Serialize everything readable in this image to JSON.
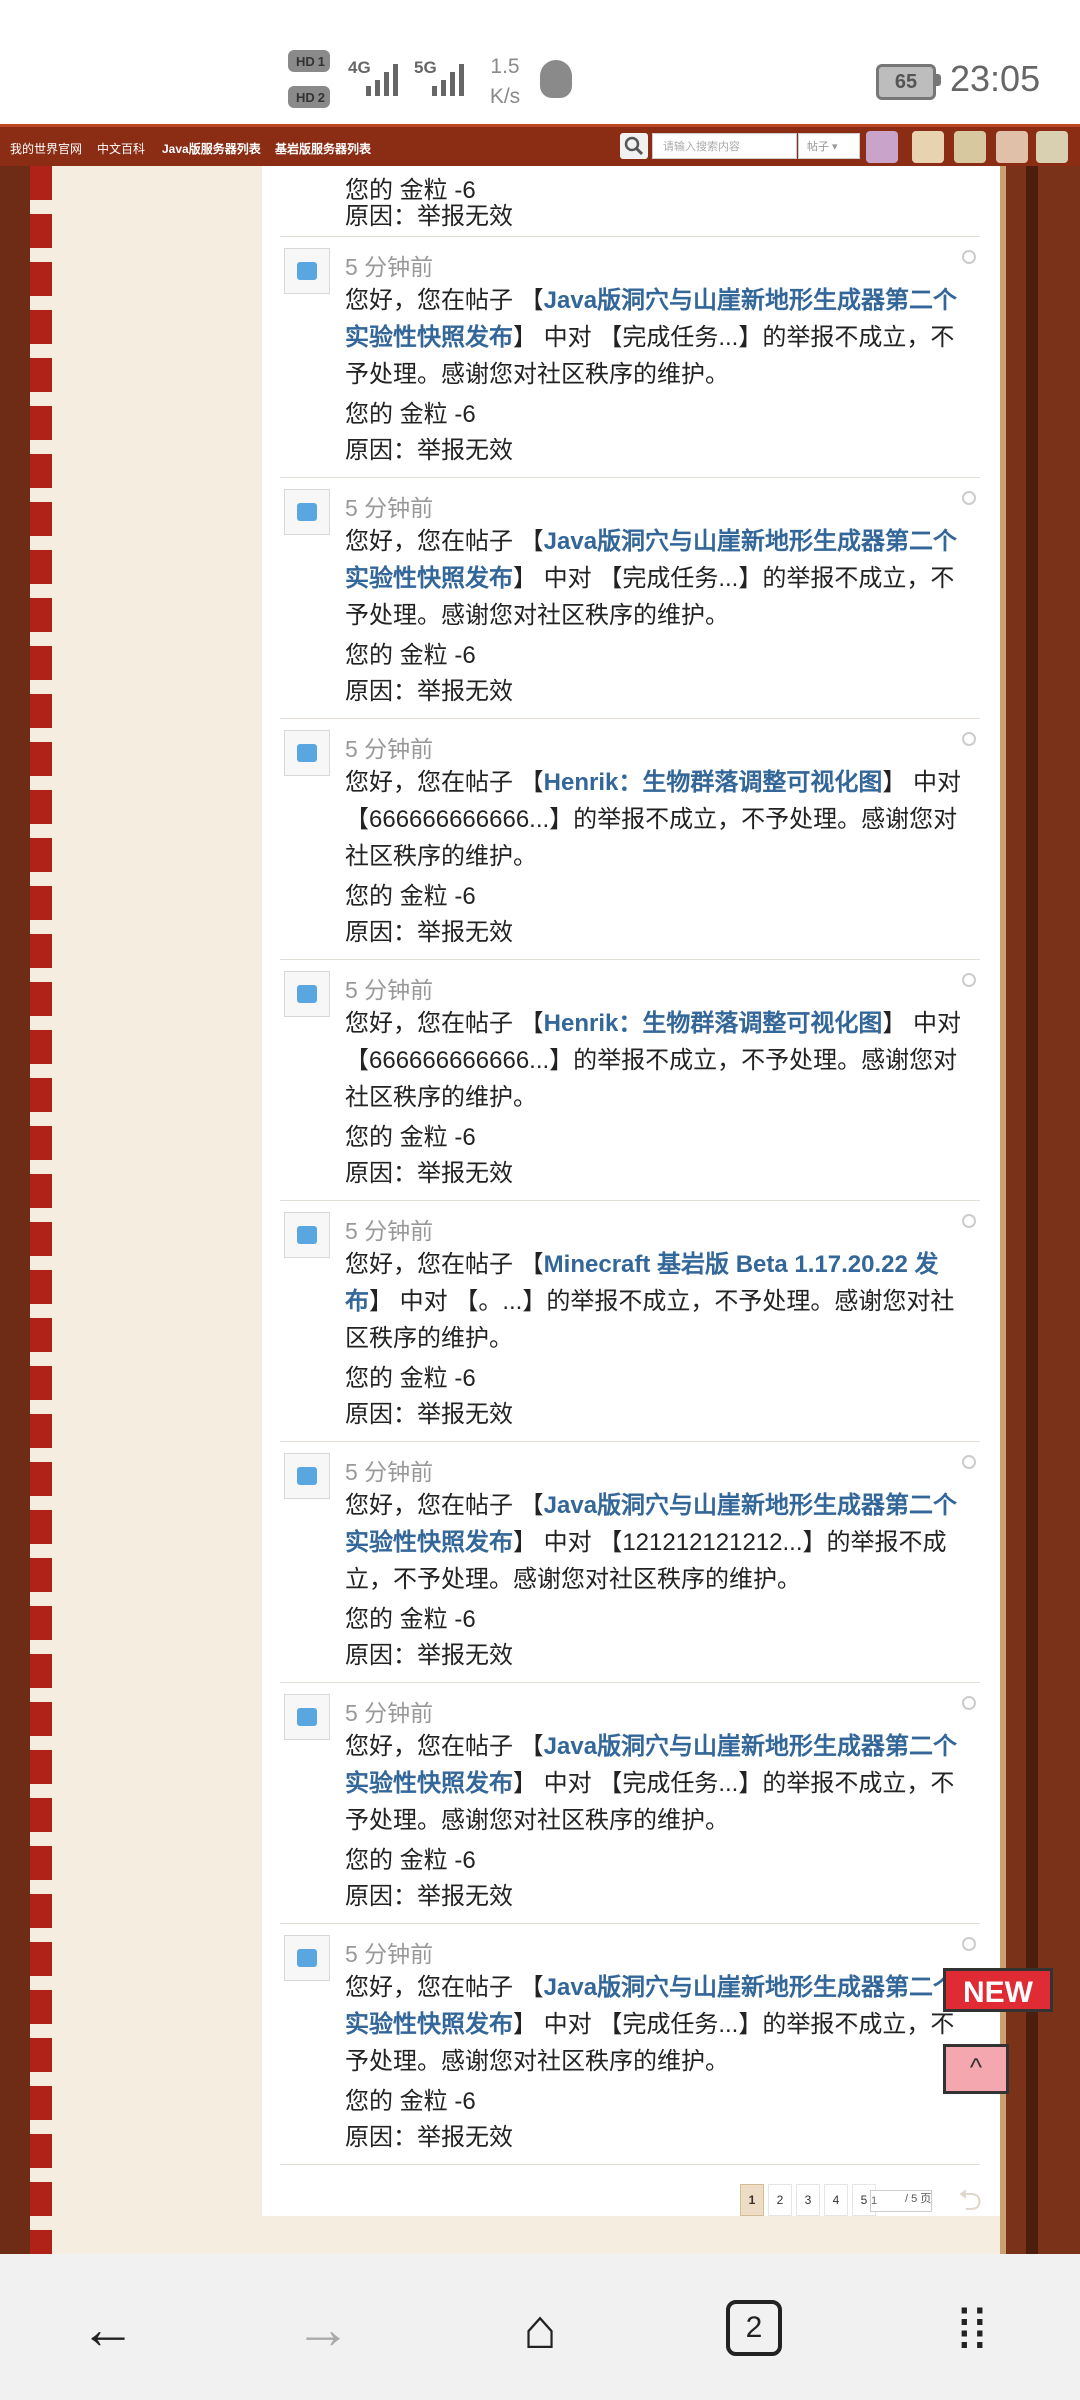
{
  "status_bar": {
    "hd1": "HD",
    "hd1_num": "1",
    "hd2": "HD",
    "hd2_num": "2",
    "net1": "4G",
    "net2": "5G",
    "speed_value": "1.5",
    "speed_unit": "K/s",
    "battery": "65",
    "time": "23:05"
  },
  "site_nav": {
    "links": [
      "我的世界官网",
      "中文百科",
      "Java版服务器列表",
      "基岩版服务器列表"
    ],
    "search_placeholder": "请输入搜索内容",
    "search_type": "帖子",
    "accent": "#8b2c14"
  },
  "top_partial": {
    "gold": "您的 金粒 -6",
    "reason": "原因：举报无效"
  },
  "notices": [
    {
      "time": "5 分钟前",
      "pre": "您好，您在帖子 【",
      "link": "Java版洞穴与山崖新地形生成器第二个实验性快照发布",
      "post": "】 中对 【完成任务...】的举报不成立，不予处理。感谢您对社区秩序的维护。",
      "gold": "您的 金粒 -6",
      "reason": "原因：举报无效"
    },
    {
      "time": "5 分钟前",
      "pre": "您好，您在帖子 【",
      "link": "Java版洞穴与山崖新地形生成器第二个实验性快照发布",
      "post": "】 中对 【完成任务...】的举报不成立，不予处理。感谢您对社区秩序的维护。",
      "gold": "您的 金粒 -6",
      "reason": "原因：举报无效"
    },
    {
      "time": "5 分钟前",
      "pre": "您好，您在帖子 【",
      "link": "Henrik：生物群落调整可视化图",
      "post": "】 中对 【666666666666...】的举报不成立，不予处理。感谢您对社区秩序的维护。",
      "gold": "您的 金粒 -6",
      "reason": "原因：举报无效"
    },
    {
      "time": "5 分钟前",
      "pre": "您好，您在帖子 【",
      "link": "Henrik：生物群落调整可视化图",
      "post": "】 中对 【666666666666...】的举报不成立，不予处理。感谢您对社区秩序的维护。",
      "gold": "您的 金粒 -6",
      "reason": "原因：举报无效"
    },
    {
      "time": "5 分钟前",
      "pre": "您好，您在帖子 【",
      "link": "Minecraft 基岩版 Beta 1.17.20.22 发布",
      "post": "】 中对 【。...】的举报不成立，不予处理。感谢您对社区秩序的维护。",
      "gold": "您的 金粒 -6",
      "reason": "原因：举报无效"
    },
    {
      "time": "5 分钟前",
      "pre": "您好，您在帖子 【",
      "link": "Java版洞穴与山崖新地形生成器第二个实验性快照发布",
      "post": "】 中对 【121212121212...】的举报不成立，不予处理。感谢您对社区秩序的维护。",
      "gold": "您的 金粒 -6",
      "reason": "原因：举报无效"
    },
    {
      "time": "5 分钟前",
      "pre": "您好，您在帖子 【",
      "link": "Java版洞穴与山崖新地形生成器第二个实验性快照发布",
      "post": "】 中对 【完成任务...】的举报不成立，不予处理。感谢您对社区秩序的维护。",
      "gold": "您的 金粒 -6",
      "reason": "原因：举报无效"
    },
    {
      "time": "5 分钟前",
      "pre": "您好，您在帖子 【",
      "link": "Java版洞穴与山崖新地形生成器第二个实验性快照发布",
      "post": "】 中对 【完成任务...】的举报不成立，不予处理。感谢您对社区秩序的维护。",
      "gold": "您的 金粒 -6",
      "reason": "原因：举报无效"
    }
  ],
  "pagination": {
    "pages": [
      "1",
      "2",
      "3",
      "4",
      "5"
    ],
    "current": "1",
    "input_value": "1",
    "total": "/ 5 页"
  },
  "badges": {
    "new": "NEW",
    "up": "^"
  },
  "bottom_nav": {
    "back": "←",
    "forward": "→",
    "home": "⌂",
    "tabs_count": "2",
    "menu": "⁞⁞"
  }
}
